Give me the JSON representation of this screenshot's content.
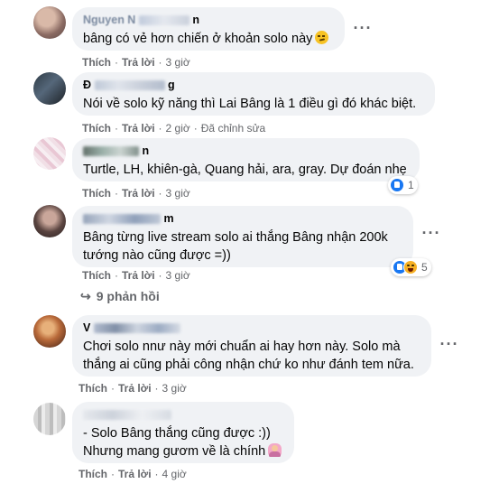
{
  "actions": {
    "like": "Thích",
    "reply": "Trả lời",
    "separator": "·"
  },
  "comments": [
    {
      "author": "Nguyen N",
      "author_suffix": "n",
      "text": "bâng có vẻ hơn chiến ở khoản solo này",
      "emoji": "smirking-face",
      "time": "3 giờ"
    },
    {
      "author": "Đ",
      "author_suffix": "g",
      "text": "Nói về solo kỹ năng thì Lai Bâng là 1 điều gì đó khác biệt.",
      "time": "2 giờ",
      "edited": "Đã chỉnh sửa"
    },
    {
      "author": "",
      "author_suffix": "n",
      "text": "Turtle, LH, khiên-gà, Quang hải, ara, gray. Dự đoán nhẹ",
      "time": "3 giờ",
      "reactions": {
        "types": [
          "like"
        ],
        "count": "1"
      }
    },
    {
      "author": "",
      "author_suffix": "m",
      "text": "Bâng từng live stream solo ai thắng Bâng nhận 200k tướng nào cũng được =))",
      "time": "3 giờ",
      "reactions": {
        "types": [
          "like",
          "haha"
        ],
        "count": "5"
      }
    },
    {
      "author": "V",
      "author_suffix": "",
      "text": "Chơi solo nnư này mới chuẩn ai hay hơn này. Solo mà thắng ai cũng phải công nhận chứ ko như đánh tem nữa.",
      "time": "3 giờ"
    },
    {
      "author": "",
      "author_suffix": "",
      "text_line1": "- Solo Bâng thắng cũng được :))",
      "text_line2": "Nhưng mang gươm về là chính",
      "emoji": "person-gesturing",
      "time": "4 giờ"
    }
  ],
  "replies_link": "9 phản hồi",
  "more_icon_glyph": "···"
}
